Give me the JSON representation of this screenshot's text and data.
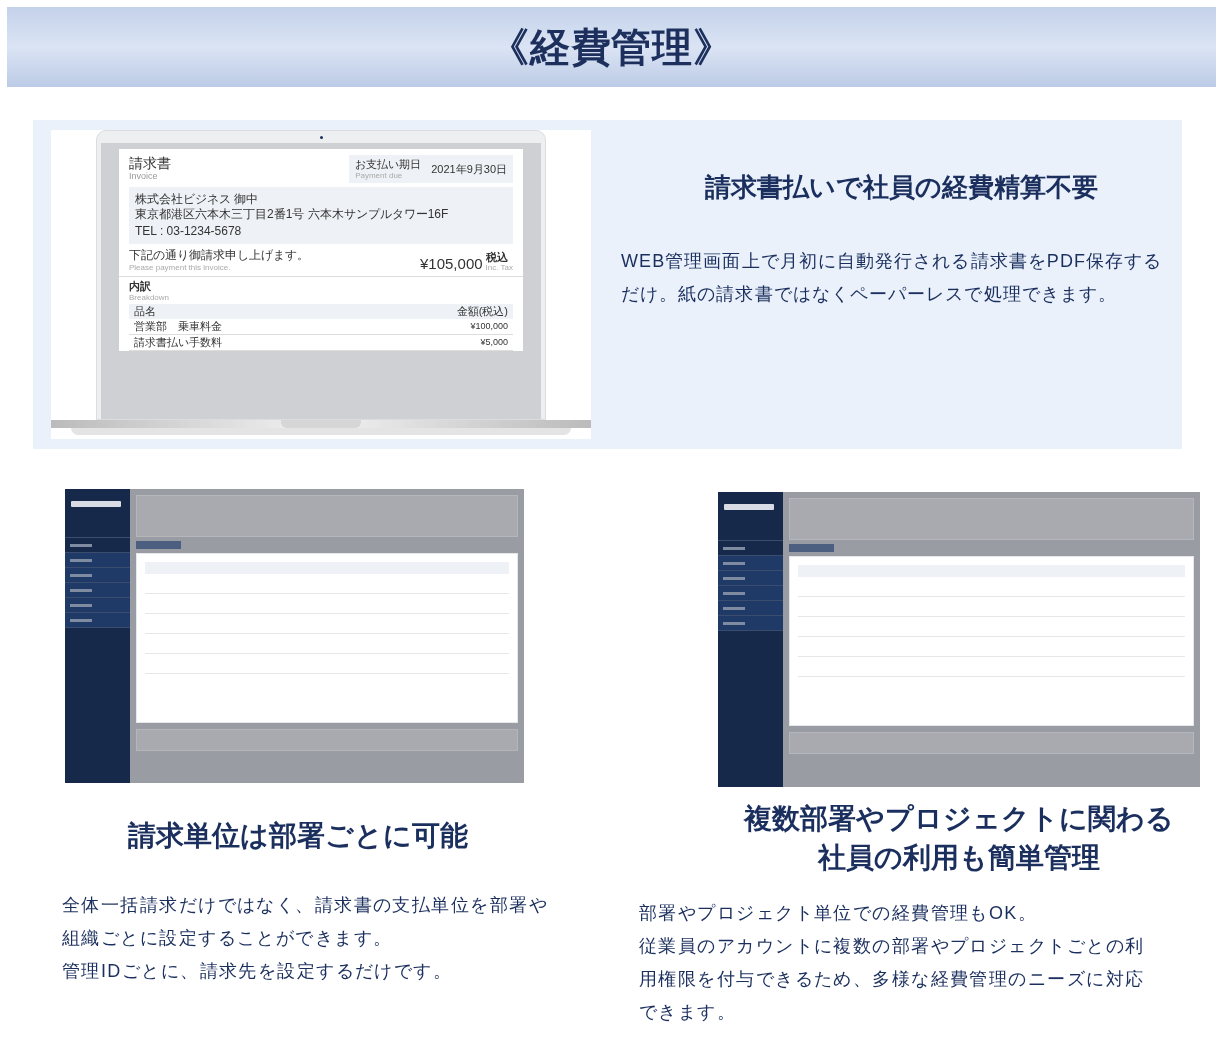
{
  "banner": {
    "title": "《経費管理》"
  },
  "feature": {
    "title": "請求書払いで社員の経費精算不要",
    "paragraphs": [
      "WEB管理画面上で月初に自動発行される請求書をPDF保存するだけ。紙の請求書ではなくペーパーレスで処理できます。"
    ],
    "invoice": {
      "title": "請求書",
      "title_en": "Invoice",
      "due_label": "お支払い期日",
      "due_label_en": "Payment due",
      "due_date": "2021年9月30日",
      "addressee": "株式会社ビジネス 御中",
      "address": "東京都港区六本木三丁目2番1号 六本木サンプルタワー16F",
      "tel": "TEL : 03-1234-5678",
      "message": "下記の通り御請求申し上げます。",
      "message_en": "Please payment this invoice.",
      "total": "¥105,000",
      "tax_label": "税込",
      "tax_label_en": "Inc. Tax",
      "breakdown": "内訳",
      "breakdown_en": "Breakdown",
      "columns": [
        "品名",
        "金額(税込)"
      ],
      "rows": [
        {
          "item": "営業部　乗車料金",
          "amount": "¥100,000"
        },
        {
          "item": "請求書払い手数料",
          "amount": "¥5,000"
        }
      ]
    }
  },
  "columns": [
    {
      "title_lines": [
        "請求単位は部署ごとに可能"
      ],
      "paragraphs": [
        "全体一括請求だけではなく、請求書の支払単位を部署や組織ごとに設定することができます。",
        "管理IDごとに、請求先を設定するだけです。"
      ]
    },
    {
      "title_lines": [
        "複数部署やプロジェクトに関わる",
        "社員の利用も簡単管理"
      ],
      "paragraphs": [
        "部署やプロジェクト単位での経費管理もOK。",
        "従業員のアカウントに複数の部署やプロジェクトごとの利用権限を付与できるため、多様な経費管理のニーズに対応できます。"
      ]
    }
  ]
}
